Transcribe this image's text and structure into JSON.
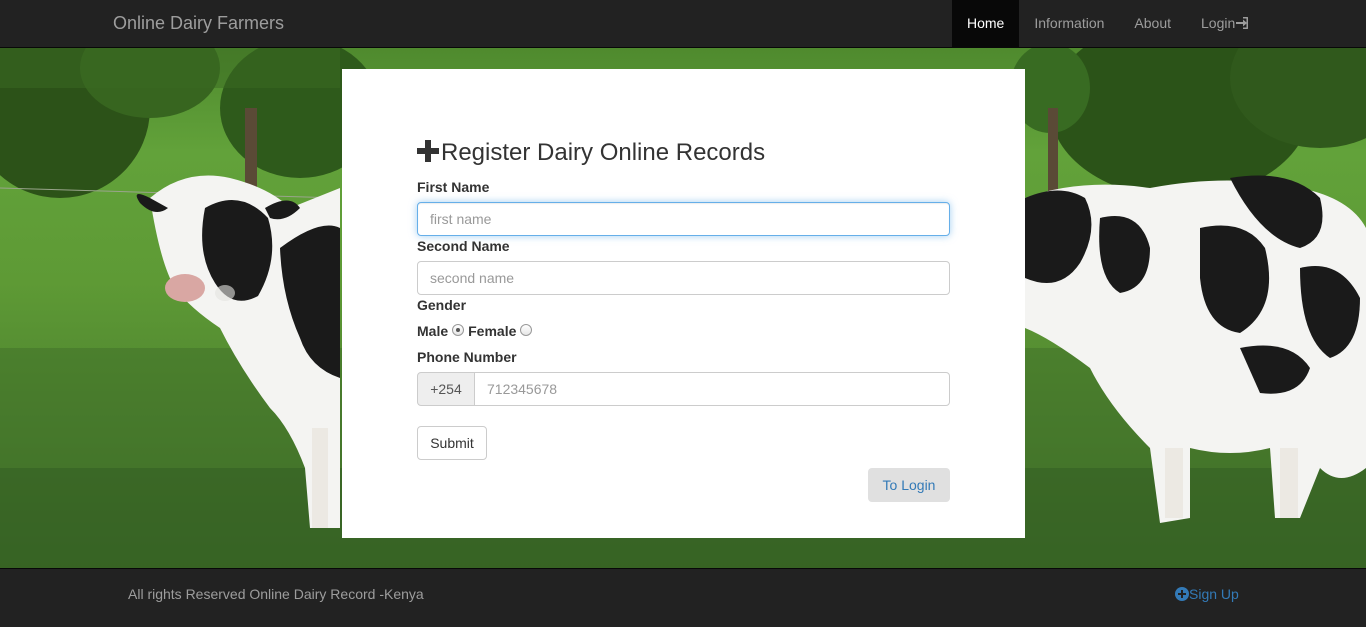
{
  "navbar": {
    "brand": "Online Dairy Farmers",
    "items": [
      {
        "label": "Home",
        "active": true
      },
      {
        "label": "Information",
        "active": false
      },
      {
        "label": "About",
        "active": false
      },
      {
        "label": "Login",
        "active": false,
        "icon": "log-in-icon"
      }
    ]
  },
  "form": {
    "title": "Register Dairy Online Records",
    "title_icon": "plus-icon",
    "first_name": {
      "label": "First Name",
      "placeholder": "first name",
      "value": ""
    },
    "second_name": {
      "label": "Second Name",
      "placeholder": "second name",
      "value": ""
    },
    "gender": {
      "label": "Gender",
      "options": [
        "Male",
        "Female"
      ],
      "selected": "Male"
    },
    "phone": {
      "label": "Phone Number",
      "prefix": "+254",
      "placeholder": "712345678",
      "value": ""
    },
    "submit_label": "Submit",
    "to_login_label": "To Login"
  },
  "footer": {
    "text": "All rights Reserved Online Dairy Record -Kenya",
    "signup_label": "Sign Up",
    "signup_icon": "plus-circle-icon"
  },
  "colors": {
    "navbar_bg": "#222222",
    "link": "#337ab7",
    "focus_border": "#66afe9"
  }
}
